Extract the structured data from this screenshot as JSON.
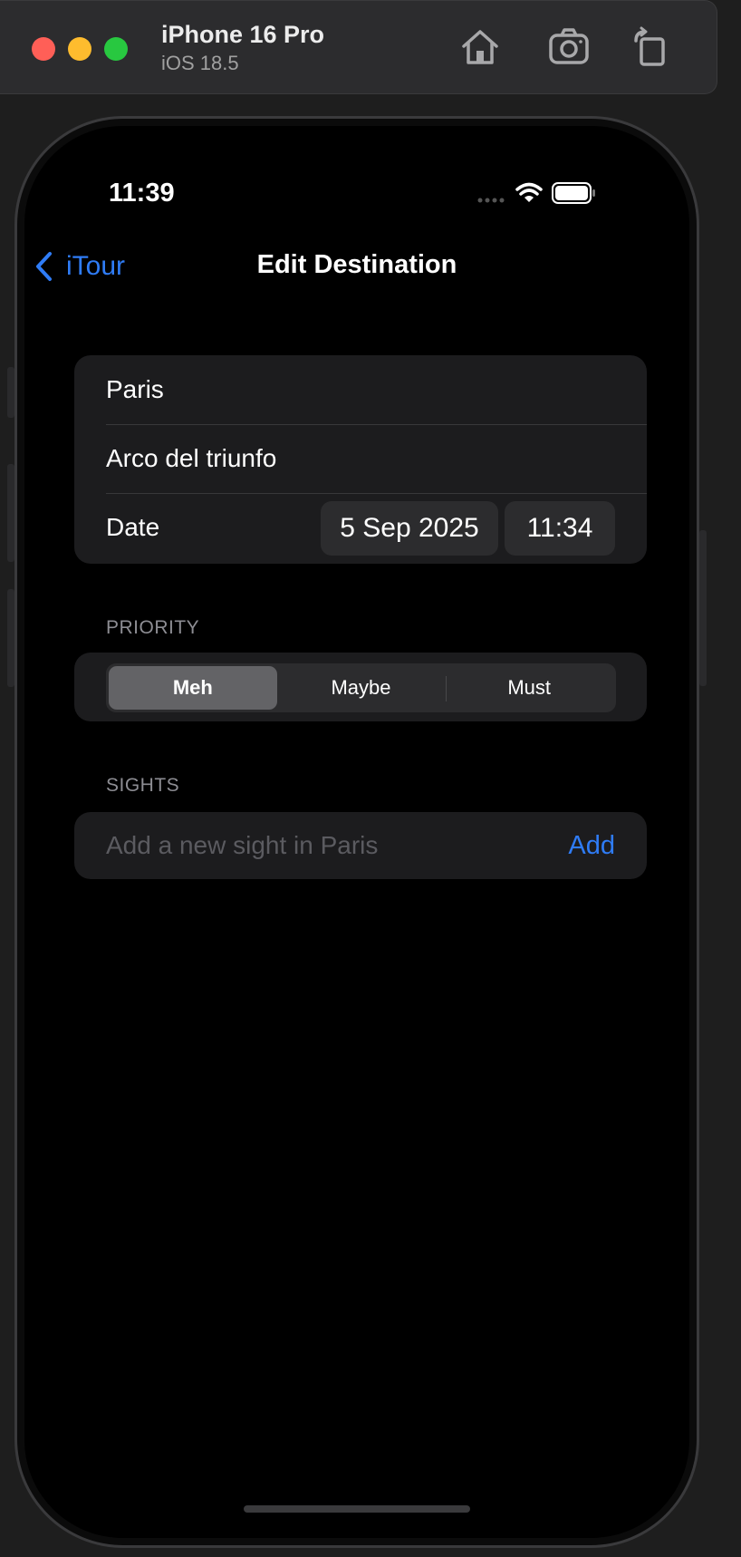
{
  "simulator": {
    "device_name": "iPhone 16 Pro",
    "os_version": "iOS 18.5",
    "toolbar_icons": [
      "home-icon",
      "screenshot-icon",
      "rotate-icon"
    ]
  },
  "status_bar": {
    "time": "11:39",
    "icons": [
      "cellular-icon",
      "wifi-icon",
      "battery-icon"
    ]
  },
  "nav": {
    "back_label": "iTour",
    "title": "Edit Destination"
  },
  "details": {
    "name": "Paris",
    "details_text": "Arco del triunfo",
    "date_label": "Date",
    "date_value": "5 Sep 2025",
    "time_value": "11:34"
  },
  "priority": {
    "header": "PRIORITY",
    "options": [
      "Meh",
      "Maybe",
      "Must"
    ],
    "selected": "Meh"
  },
  "sights": {
    "header": "SIGHTS",
    "placeholder": "Add a new sight in Paris",
    "add_label": "Add"
  },
  "colors": {
    "accent": "#2f7cf6",
    "background": "#000000",
    "group_background": "#1c1c1e"
  }
}
